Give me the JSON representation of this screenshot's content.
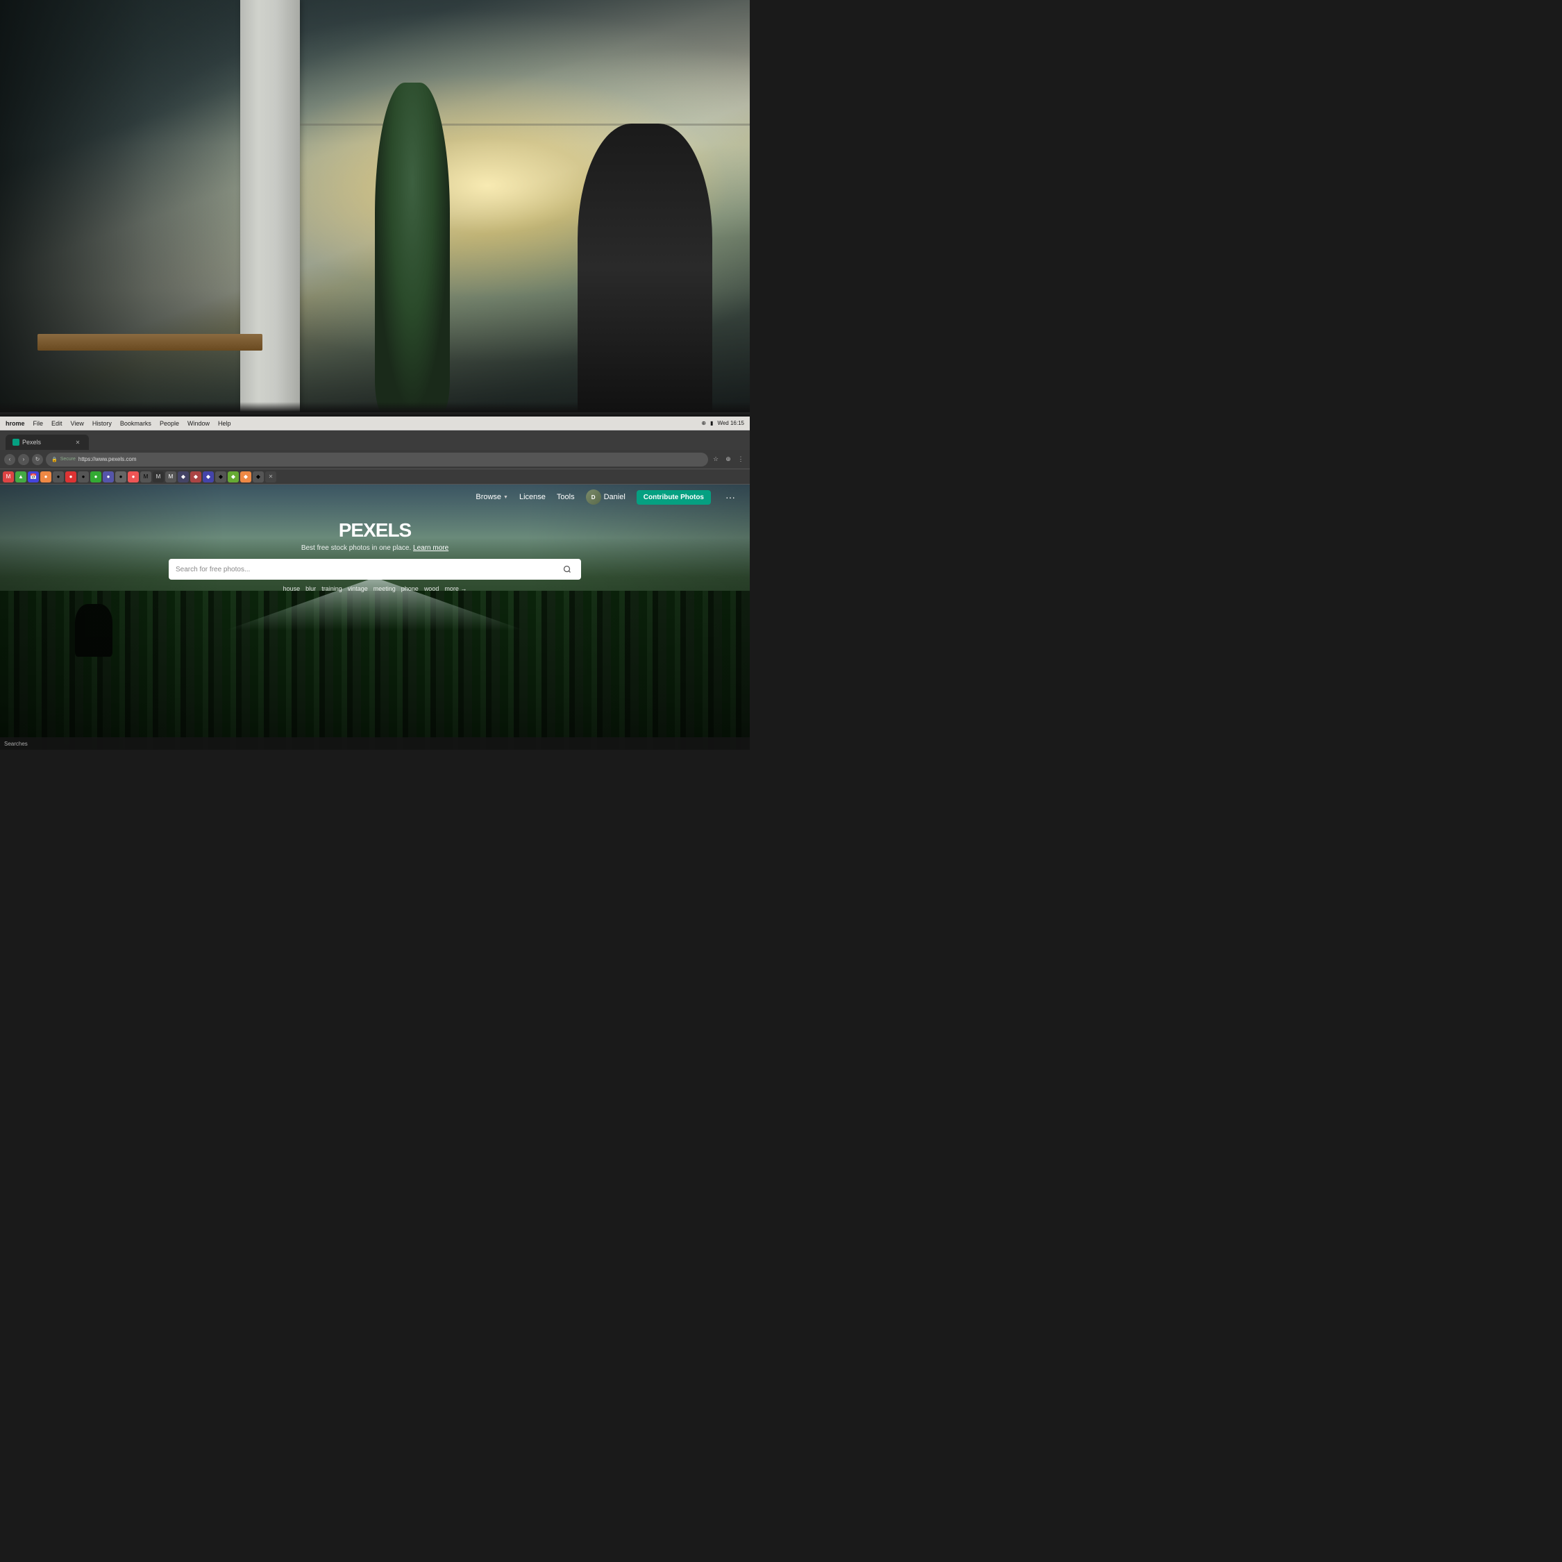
{
  "background": {
    "description": "Office interior photo - blurred background"
  },
  "mac_menubar": {
    "app_name": "hrome",
    "menu_items": [
      "File",
      "Edit",
      "View",
      "History",
      "Bookmarks",
      "People",
      "Window",
      "Help"
    ],
    "right_items": {
      "time": "Wed 16:15",
      "battery": "100 %",
      "wifi": "WiFi"
    }
  },
  "chrome": {
    "tab": {
      "title": "Pexels",
      "favicon_color": "#05a081"
    },
    "omnibar": {
      "url": "https://www.pexels.com",
      "secure_label": "Secure",
      "back_btn": "‹",
      "forward_btn": "›",
      "reload_btn": "↻"
    }
  },
  "pexels": {
    "nav": {
      "browse_label": "Browse",
      "license_label": "License",
      "tools_label": "Tools",
      "user_name": "Daniel",
      "contribute_btn": "Contribute Photos",
      "more_btn": "···"
    },
    "hero": {
      "logo": "PEXELS",
      "tagline": "Best free stock photos in one place.",
      "learn_more": "Learn more",
      "search_placeholder": "Search for free photos...",
      "tags": [
        "house",
        "blur",
        "training",
        "vintage",
        "meeting",
        "phone",
        "wood",
        "more →"
      ]
    }
  },
  "taskbar": {
    "searches_label": "Searches"
  }
}
